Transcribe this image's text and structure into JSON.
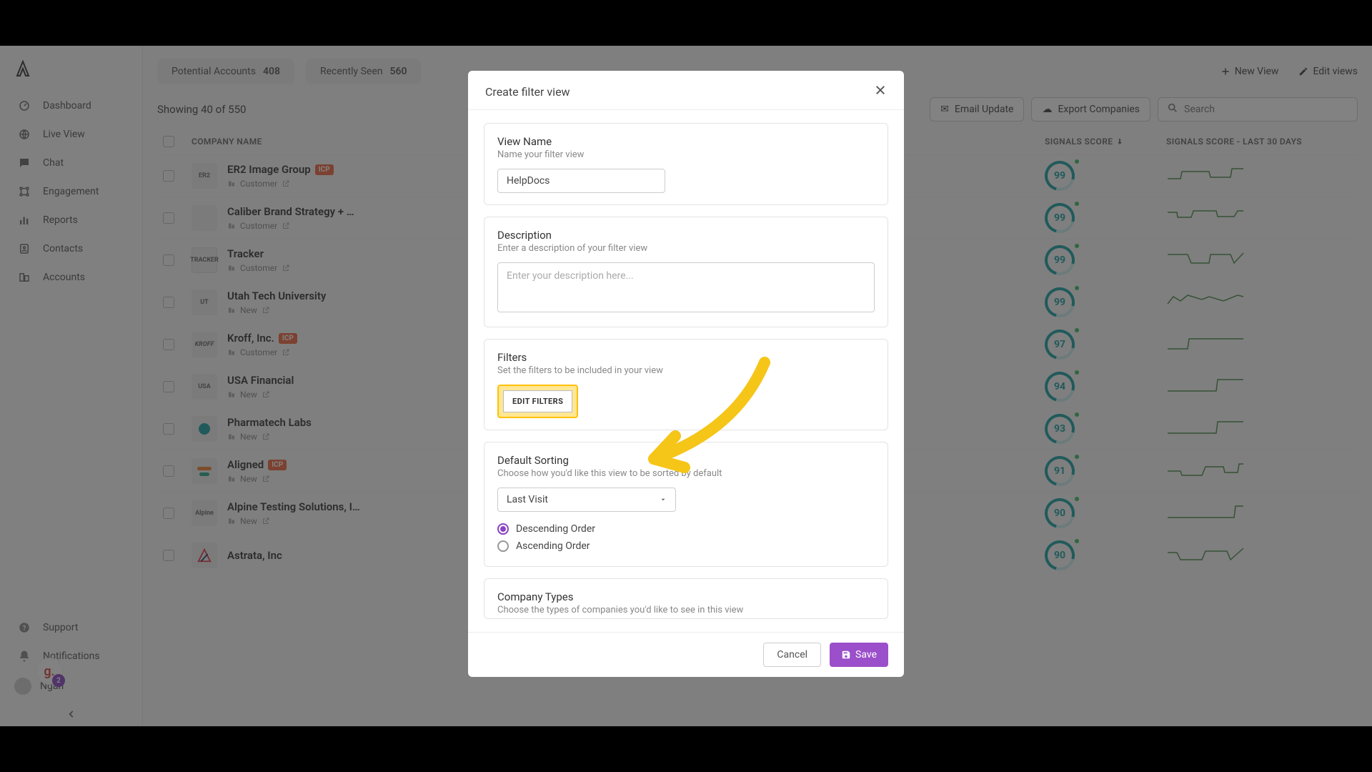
{
  "sidebar": {
    "items": [
      {
        "label": "Dashboard",
        "icon": "dashboard-icon"
      },
      {
        "label": "Live View",
        "icon": "globe-icon"
      },
      {
        "label": "Chat",
        "icon": "chat-icon"
      },
      {
        "label": "Engagement",
        "icon": "engagement-icon"
      },
      {
        "label": "Reports",
        "icon": "bars-icon"
      },
      {
        "label": "Contacts",
        "icon": "contacts-icon"
      },
      {
        "label": "Accounts",
        "icon": "accounts-icon"
      }
    ],
    "bottom": {
      "support": "Support",
      "notifications": "Notifications",
      "user_name": "Ngan",
      "g_badge": "g.",
      "g_count": "2"
    }
  },
  "tabs": [
    {
      "label": "Potential Accounts",
      "count": "408"
    },
    {
      "label": "Recently Seen",
      "count": "560"
    }
  ],
  "view_actions": {
    "new_view": "New View",
    "edit_views": "Edit views"
  },
  "toolbar": {
    "showing_text": "Showing 40 of  550",
    "email_update": "Email Update",
    "export": "Export Companies",
    "search_placeholder": "Search"
  },
  "table": {
    "headers": {
      "company": "COMPANY NAME",
      "score": "SIGNALS SCORE",
      "score30": "SIGNALS SCORE - LAST 30 DAYS"
    },
    "rows": [
      {
        "name": "ER2 Image Group",
        "badge": "ICP",
        "status": "Customer",
        "score": "99",
        "logo": "l-er2",
        "logo_text": "ER2"
      },
      {
        "name": "Caliber Brand Strategy + …",
        "badge": null,
        "status": "Customer",
        "score": "99",
        "logo": "l-caliber",
        "logo_text": ""
      },
      {
        "name": "Tracker",
        "badge": null,
        "status": "Customer",
        "score": "99",
        "logo": "l-tracker",
        "logo_text": "TRACKER"
      },
      {
        "name": "Utah Tech University",
        "badge": null,
        "status": "New",
        "score": "99",
        "logo": "l-utah",
        "logo_text": "UT"
      },
      {
        "name": "Kroff, Inc.",
        "badge": "ICP",
        "status": "Customer",
        "score": "97",
        "logo": "l-kroff",
        "logo_text": "KROFF"
      },
      {
        "name": "USA Financial",
        "badge": null,
        "status": "New",
        "score": "94",
        "logo": "l-usa",
        "logo_text": "USA"
      },
      {
        "name": "Pharmatech Labs",
        "badge": null,
        "status": "New",
        "score": "93",
        "logo": "l-pharma",
        "logo_text": ""
      },
      {
        "name": "Aligned",
        "badge": "ICP",
        "status": "New",
        "score": "91",
        "logo": "l-aligned",
        "logo_text": ""
      },
      {
        "name": "Alpine Testing Solutions, I…",
        "badge": null,
        "status": "New",
        "score": "90",
        "logo": "l-alpine",
        "logo_text": "Alpine"
      },
      {
        "name": "Astrata, Inc",
        "badge": null,
        "status": "",
        "score": "90",
        "logo": "l-astrata",
        "logo_text": "A"
      }
    ]
  },
  "modal": {
    "title": "Create filter view",
    "view_name": {
      "title": "View Name",
      "sub": "Name your filter view",
      "value": "HelpDocs"
    },
    "description": {
      "title": "Description",
      "sub": "Enter a description of your filter view",
      "placeholder": "Enter your description here..."
    },
    "filters": {
      "title": "Filters",
      "sub": "Set the filters to be included in your view",
      "button": "EDIT FILTERS"
    },
    "sorting": {
      "title": "Default Sorting",
      "sub": "Choose how you'd like this view to be sorted by default",
      "selected": "Last Visit",
      "desc": "Descending Order",
      "asc": "Ascending Order"
    },
    "company_types": {
      "title": "Company Types",
      "sub": "Choose the types of companies you'd like to see in this view"
    },
    "footer": {
      "cancel": "Cancel",
      "save": "Save"
    }
  }
}
